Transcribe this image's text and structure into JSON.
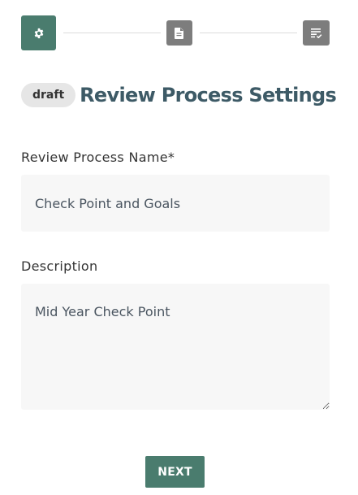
{
  "stepper": {
    "steps": [
      {
        "icon": "gear-icon",
        "state": "active",
        "color": "#4a7c6e"
      },
      {
        "icon": "document-icon",
        "state": "inactive",
        "color": "#7d7d7d"
      },
      {
        "icon": "checklist-icon",
        "state": "inactive",
        "color": "#7d7d7d"
      }
    ]
  },
  "header": {
    "badge": "draft",
    "title": "Review Process Settings"
  },
  "form": {
    "name_label": "Review Process Name*",
    "name_value": "Check Point and Goals",
    "description_label": "Description",
    "description_value": "Mid Year Check Point"
  },
  "actions": {
    "next_label": "NEXT"
  },
  "colors": {
    "accent": "#4a7c6e",
    "title": "#3d5a66",
    "inactive_step": "#7d7d7d",
    "field_background": "#f7f7f7"
  }
}
